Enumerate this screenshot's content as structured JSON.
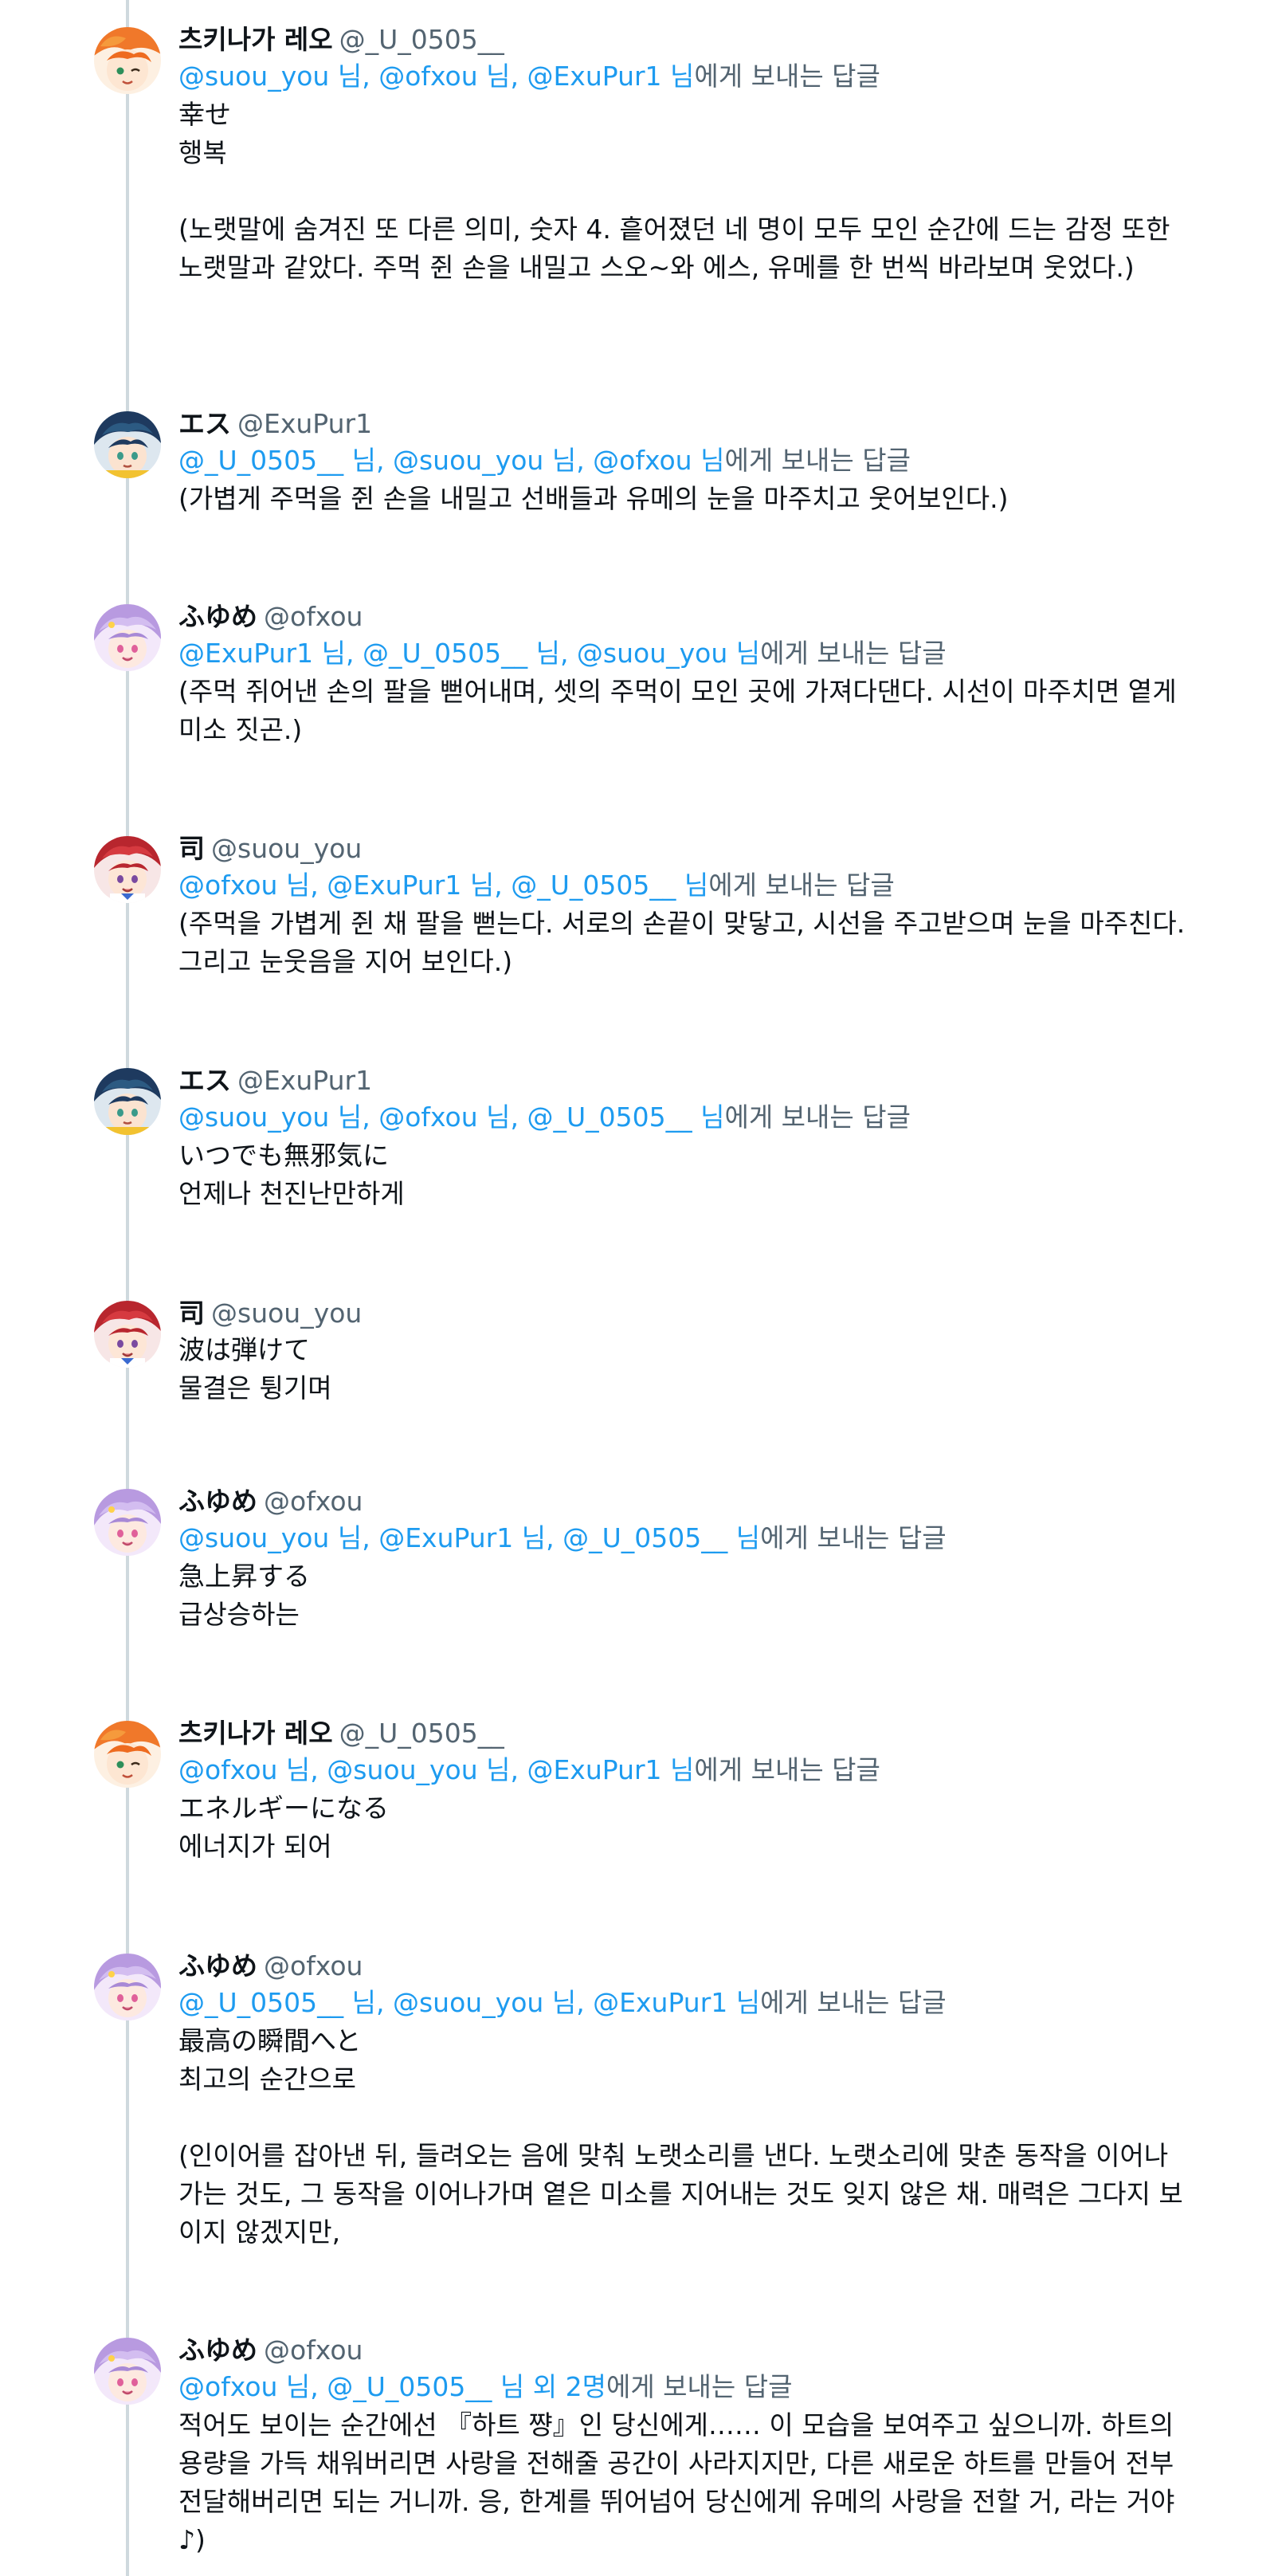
{
  "reply_suffix": "에게 보내는 답글",
  "tweets": [
    {
      "name": "츠키나가 레오",
      "handle": "@_U_0505__",
      "avatar": "orange",
      "mentions": [
        "@suou_you 님",
        "@ofxou 님",
        "@ExuPur1 님"
      ],
      "text": "幸せ\n행복\n\n(노랫말에 숨겨진 또 다른 의미, 숫자 4. 흩어졌던 네 명이 모두 모인 순간에 드는 감정 또한 노랫말과 같았다. 주먹 쥔 손을 내밀고 스오~와 에스, 유메를 한 번씩 바라보며 웃었다.)"
    },
    {
      "name": "エス",
      "handle": "@ExuPur1",
      "avatar": "navy",
      "mentions": [
        "@_U_0505__ 님",
        "@suou_you 님",
        "@ofxou 님"
      ],
      "text": "(가볍게 주먹을 쥔 손을 내밀고 선배들과 유메의 눈을 마주치고 웃어보인다.)"
    },
    {
      "name": "ふゆめ",
      "handle": "@ofxou",
      "avatar": "lavender",
      "mentions": [
        "@ExuPur1 님",
        "@_U_0505__ 님",
        "@suou_you 님"
      ],
      "text": "(주먹 쥐어낸 손의 팔을 뻗어내며, 셋의 주먹이 모인 곳에 가져다댄다. 시선이 마주치면 옅게 미소 짓곤.)"
    },
    {
      "name": "司",
      "handle": "@suou_you",
      "avatar": "red",
      "mentions": [
        "@ofxou 님",
        "@ExuPur1 님",
        "@_U_0505__ 님"
      ],
      "text": "(주먹을 가볍게 쥔 채 팔을 뻗는다. 서로의 손끝이 맞닿고, 시선을 주고받으며 눈을 마주친다. 그리고 눈웃음을 지어 보인다.)"
    },
    {
      "name": "エス",
      "handle": "@ExuPur1",
      "avatar": "navy",
      "mentions": [
        "@suou_you 님",
        "@ofxou 님",
        "@_U_0505__ 님"
      ],
      "text": "いつでも無邪気に\n언제나 천진난만하게"
    },
    {
      "name": "司",
      "handle": "@suou_you",
      "avatar": "red",
      "mentions": [],
      "text": "波は弾けて\n물결은 튕기며"
    },
    {
      "name": "ふゆめ",
      "handle": "@ofxou",
      "avatar": "lavender",
      "mentions": [
        "@suou_you 님",
        "@ExuPur1 님",
        "@_U_0505__ 님"
      ],
      "text": "急上昇する\n급상승하는"
    },
    {
      "name": "츠키나가 레오",
      "handle": "@_U_0505__",
      "avatar": "orange",
      "mentions": [
        "@ofxou 님",
        "@suou_you 님",
        "@ExuPur1 님"
      ],
      "text": "エネルギーになる\n에너지가 되어"
    },
    {
      "name": "ふゆめ",
      "handle": "@ofxou",
      "avatar": "lavender",
      "mentions": [
        "@_U_0505__ 님",
        "@suou_you 님",
        "@ExuPur1 님"
      ],
      "text": "最高の瞬間へと\n최고의 순간으로\n\n(인이어를 잡아낸 뒤, 들려오는 음에 맞춰 노랫소리를 낸다. 노랫소리에 맞춘 동작을 이어나가는 것도, 그 동작을 이어나가며 옅은 미소를 지어내는 것도 잊지 않은 채. 매력은 그다지 보이지 않겠지만,"
    },
    {
      "name": "ふゆめ",
      "handle": "@ofxou",
      "avatar": "lavender",
      "mentions": [
        "@ofxou 님",
        "@_U_0505__ 님 외 2명"
      ],
      "text": "적어도 보이는 순간에선 『하트 쨩』인 당신에게…… 이 모습을 보여주고 싶으니까. 하트의 용량을 가득 채워버리면 사랑을 전해줄 공간이 사라지지만, 다른 새로운 하트를 만들어 전부 전달해버리면 되는 거니까. 응, 한계를 뛰어넘어 당신에게 유메의 사랑을 전할 거, 라는 거야♪)"
    }
  ]
}
